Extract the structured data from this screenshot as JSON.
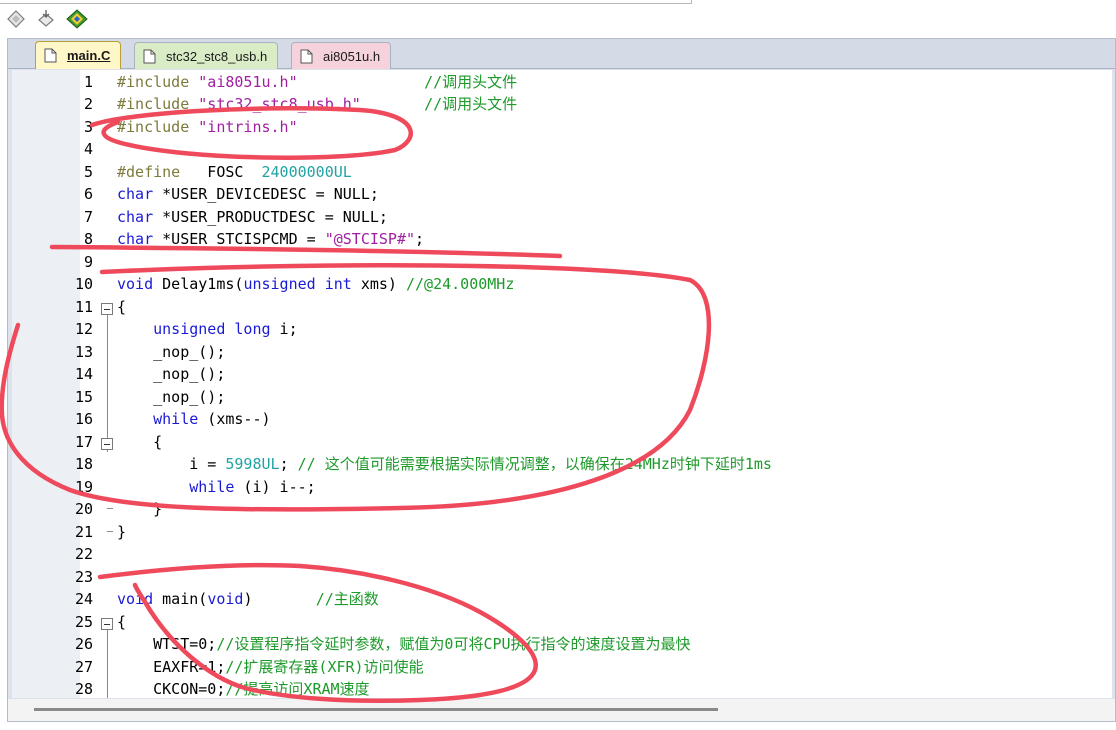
{
  "toolbar": {
    "buttons": [
      {
        "icon": "diamond-outline-icon"
      },
      {
        "icon": "diamond-arrow-icon"
      },
      {
        "icon": "multi-color-build-icon"
      }
    ]
  },
  "tabs": [
    {
      "label": "main.C",
      "active": true
    },
    {
      "label": "stc32_stc8_usb.h",
      "active": false
    },
    {
      "label": "ai8051u.h",
      "active": false
    }
  ],
  "code": {
    "lines": [
      {
        "num": "1",
        "text": "#include \"ai8051u.h\"              //调用头文件"
      },
      {
        "num": "2",
        "text": "#include \"stc32_stc8_usb.h\"       //调用头文件"
      },
      {
        "num": "3",
        "text": "#include \"intrins.h\""
      },
      {
        "num": "4",
        "text": ""
      },
      {
        "num": "5",
        "text": "#define   FOSC  24000000UL"
      },
      {
        "num": "6",
        "text": "char *USER_DEVICEDESC = NULL;"
      },
      {
        "num": "7",
        "text": "char *USER_PRODUCTDESC = NULL;"
      },
      {
        "num": "8",
        "text": "char *USER_STCISPCMD = \"@STCISP#\";"
      },
      {
        "num": "9",
        "text": ""
      },
      {
        "num": "10",
        "text": "void Delay1ms(unsigned int xms) //@24.000MHz"
      },
      {
        "num": "11",
        "text": "{"
      },
      {
        "num": "12",
        "text": "    unsigned long i;"
      },
      {
        "num": "13",
        "text": "    _nop_();"
      },
      {
        "num": "14",
        "text": "    _nop_();"
      },
      {
        "num": "15",
        "text": "    _nop_();"
      },
      {
        "num": "16",
        "text": "    while (xms--)"
      },
      {
        "num": "17",
        "text": "    {"
      },
      {
        "num": "18",
        "text": "        i = 5998UL; // 这个值可能需要根据实际情况调整，以确保在24MHz时钟下延时1ms"
      },
      {
        "num": "19",
        "text": "        while (i) i--;"
      },
      {
        "num": "20",
        "text": "    }"
      },
      {
        "num": "21",
        "text": "}"
      },
      {
        "num": "22",
        "text": ""
      },
      {
        "num": "23",
        "text": ""
      },
      {
        "num": "24",
        "text": "void main(void)       //主函数"
      },
      {
        "num": "25",
        "text": "{"
      },
      {
        "num": "26",
        "text": "    WTST=0;//设置程序指令延时参数，赋值为0可将CPU执行指令的速度设置为最快"
      },
      {
        "num": "27",
        "text": "    EAXFR=1;//扩展寄存器(XFR)访问使能"
      },
      {
        "num": "28",
        "text": "    CKCON=0;//提高访问XRAM速度"
      }
    ]
  },
  "colors": {
    "preprocessor": "#7d7a3b",
    "string": "#a020a0",
    "keyword": "#1a1ad6",
    "comment": "#1d9a2a",
    "number": "#22a3a3",
    "annotation": "#ef4a5c",
    "active_tab": "#fff7c7"
  }
}
